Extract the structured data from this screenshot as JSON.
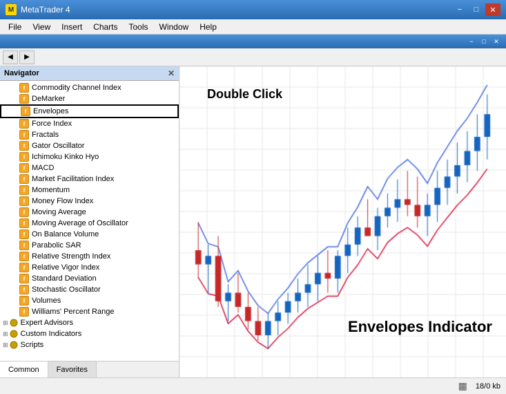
{
  "titleBar": {
    "title": "MetaTrader 4",
    "minimize": "−",
    "maximize": "□",
    "close": "✕"
  },
  "menuBar": {
    "items": [
      "File",
      "View",
      "Insert",
      "Charts",
      "Tools",
      "Window",
      "Help"
    ]
  },
  "docTitleBar": {
    "title": "",
    "minimize": "−",
    "maximize": "□",
    "close": "✕"
  },
  "navigator": {
    "title": "Navigator",
    "closeBtn": "✕"
  },
  "indicators": [
    "Commodity Channel Index",
    "DeMarker",
    "Envelopes",
    "Force Index",
    "Fractals",
    "Gator Oscillator",
    "Ichimoku Kinko Hyo",
    "MACD",
    "Market Facilitation Index",
    "Momentum",
    "Money Flow Index",
    "Moving Average",
    "Moving Average of Oscillator",
    "On Balance Volume",
    "Parabolic SAR",
    "Relative Strength Index",
    "Relative Vigor Index",
    "Standard Deviation",
    "Stochastic Oscillator",
    "Volumes",
    "Williams' Percent Range"
  ],
  "groups": [
    "Expert Advisors",
    "Custom Indicators",
    "Scripts"
  ],
  "tabs": {
    "common": "Common",
    "favorites": "Favorites"
  },
  "chartLabels": {
    "doubleClick": "Double Click",
    "envelopesIndicator": "Envelopes Indicator"
  },
  "statusBar": {
    "memory": "18/0 kb"
  }
}
